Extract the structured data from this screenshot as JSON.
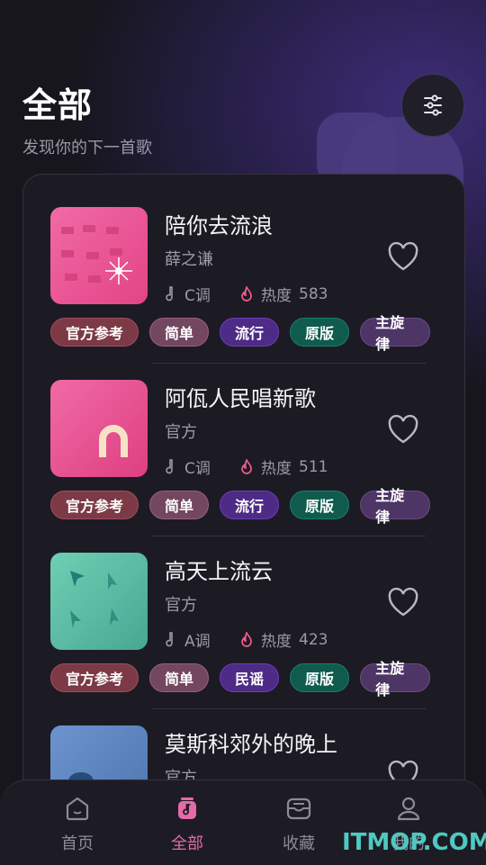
{
  "header": {
    "title": "全部",
    "subtitle": "发现你的下一首歌"
  },
  "colors": {
    "accent": "#e46aa9",
    "heat": "#ef5a8e"
  },
  "songs": [
    {
      "name": "陪你去流浪",
      "artist": "薛之谦",
      "key": "C调",
      "heat_label": "热度",
      "heat": "583",
      "cover": "pink-sparkle",
      "tags": [
        "官方参考",
        "简单",
        "流行",
        "原版",
        "主旋律"
      ]
    },
    {
      "name": "阿佤人民唱新歌",
      "artist": "官方",
      "key": "C调",
      "heat_label": "热度",
      "heat": "511",
      "cover": "pink-arch",
      "tags": [
        "官方参考",
        "简单",
        "流行",
        "原版",
        "主旋律"
      ]
    },
    {
      "name": "高天上流云",
      "artist": "官方",
      "key": "A调",
      "heat_label": "热度",
      "heat": "423",
      "cover": "teal-arrows",
      "tags": [
        "官方参考",
        "简单",
        "民谣",
        "原版",
        "主旋律"
      ]
    },
    {
      "name": "莫斯科郊外的晚上",
      "artist": "官方",
      "cover": "blue"
    }
  ],
  "tabbar": [
    {
      "label": "首页",
      "icon": "home-icon"
    },
    {
      "label": "全部",
      "icon": "music-note-icon",
      "active": true
    },
    {
      "label": "收藏",
      "icon": "inbox-icon"
    },
    {
      "label": "我的",
      "icon": "user-icon"
    }
  ],
  "watermark": {
    "text": "ITMOP.COM"
  }
}
